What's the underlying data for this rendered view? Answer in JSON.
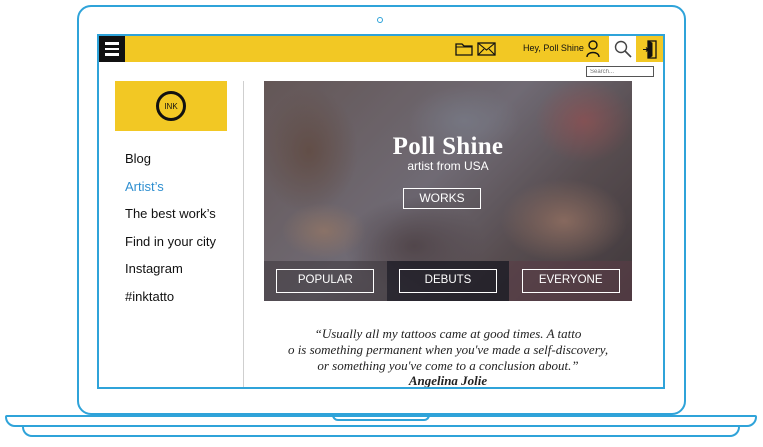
{
  "colors": {
    "frame": "#2fa3d9",
    "accent": "#f2c824",
    "link_active": "#2f8fd0"
  },
  "header": {
    "menu_icon": "hamburger-icon",
    "icons": [
      "folder-icon",
      "mail-icon",
      "user-icon",
      "search-icon",
      "exit-door-icon"
    ],
    "greeting": "Hey, Poll Shine",
    "search_placeholder": "Search..."
  },
  "logo": {
    "text": "INK"
  },
  "sidebar": {
    "items": [
      {
        "label": "Blog",
        "active": false
      },
      {
        "label": "Artist’s",
        "active": true
      },
      {
        "label": "The best work’s",
        "active": false
      },
      {
        "label": "Find in your city",
        "active": false
      },
      {
        "label": "Instagram",
        "active": false
      },
      {
        "label": "#inktatto",
        "active": false
      }
    ]
  },
  "hero": {
    "name": "Poll Shine",
    "subtitle": "artist from USA",
    "works_button": "WORKS",
    "tabs": [
      "POPULAR",
      "DEBUTS",
      "EVERYONE"
    ]
  },
  "quote": {
    "line1": "“Usually all my tattoos came at good times. A tatto",
    "line2": "o is something permanent when you've made a self-discovery,",
    "line3": "or something you've come to a conclusion about.”",
    "author": "Angelina Jolie"
  }
}
